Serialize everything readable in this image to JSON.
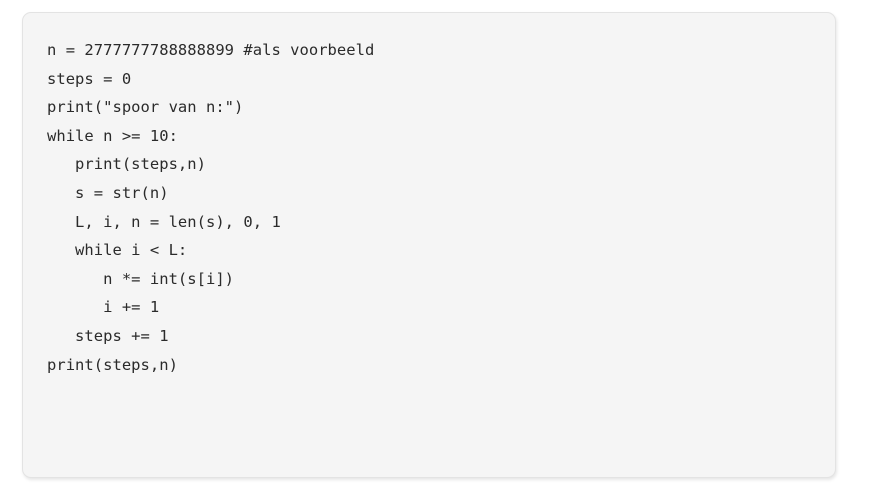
{
  "code_block": {
    "language": "python",
    "background_color": "#f5f5f5",
    "border_color": "#e3e3e3",
    "text_color": "#2b2b2b",
    "lines": [
      "n = 2777777788888899 #als voorbeeld",
      "steps = 0",
      "print(\"spoor van n:\")",
      "while n >= 10:",
      "   print(steps,n)",
      "   s = str(n)",
      "   L, i, n = len(s), 0, 1",
      "   while i < L:",
      "      n *= int(s[i])",
      "      i += 1",
      "   steps += 1",
      "print(steps,n)"
    ]
  }
}
